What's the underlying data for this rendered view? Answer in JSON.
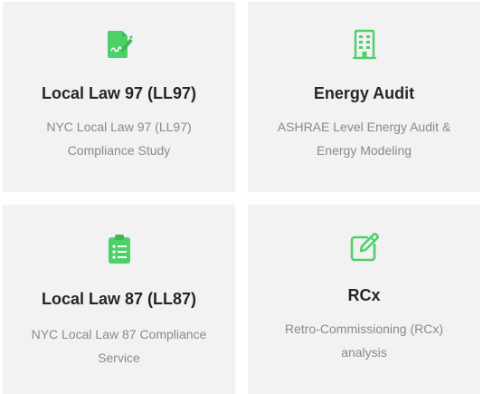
{
  "colors": {
    "accent": "#4cd169",
    "card_bg": "#f2f2f2",
    "title": "#262626",
    "desc": "#8a8a8a"
  },
  "cards": [
    {
      "icon": "document-signature-icon",
      "title": "Local Law 97 (LL97)",
      "desc_lines": [
        "NYC Local Law 97 (LL97)",
        "Compliance Study"
      ]
    },
    {
      "icon": "building-icon",
      "title": "Energy Audit",
      "desc_lines": [
        "ASHRAE Level Energy Audit &",
        "Energy Modeling"
      ]
    },
    {
      "icon": "clipboard-list-icon",
      "title": "Local Law 87 (LL87)",
      "desc_lines": [
        "NYC Local Law 87 Compliance",
        "Service"
      ]
    },
    {
      "icon": "edit-icon",
      "title": "RCx",
      "desc_lines": [
        "Retro-Commissioning (RCx)",
        "analysis"
      ]
    }
  ]
}
